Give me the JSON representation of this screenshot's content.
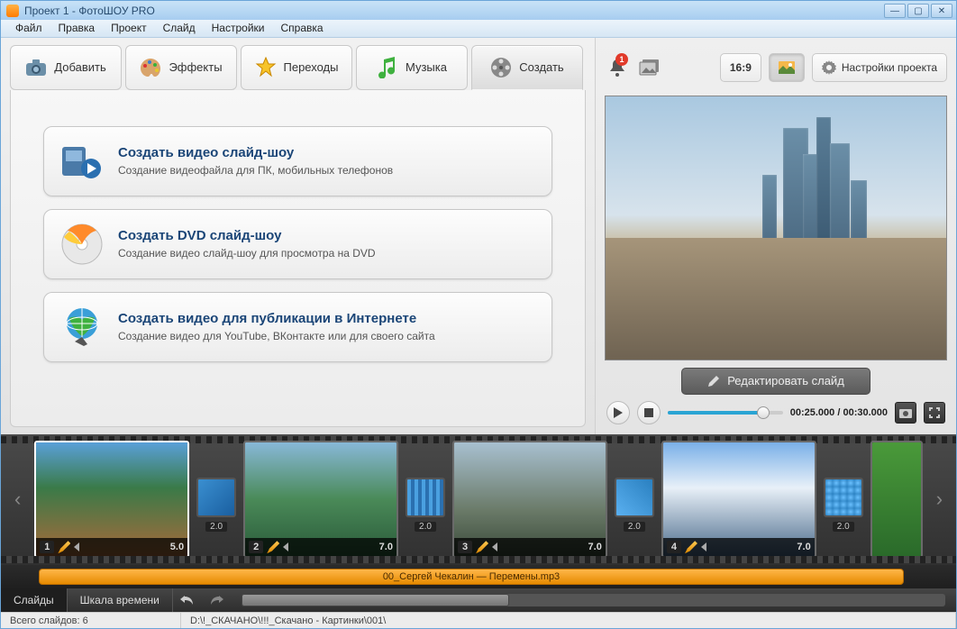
{
  "window": {
    "title": "Проект 1 - ФотоШОУ PRO"
  },
  "menu": [
    "Файл",
    "Правка",
    "Проект",
    "Слайд",
    "Настройки",
    "Справка"
  ],
  "tabs": {
    "add": "Добавить",
    "effects": "Эффекты",
    "transitions": "Переходы",
    "music": "Музыка",
    "create": "Создать"
  },
  "create_options": [
    {
      "title": "Создать видео слайд-шоу",
      "desc": "Создание видеофайла для ПК, мобильных телефонов"
    },
    {
      "title": "Создать DVD слайд-шоу",
      "desc": "Создание видео слайд-шоу для просмотра на DVD"
    },
    {
      "title": "Создать видео для публикации в Интернете",
      "desc": "Создание видео для YouTube, ВКонтакте или для своего сайта"
    }
  ],
  "right": {
    "notifications": "1",
    "aspect": "16:9",
    "settings": "Настройки проекта",
    "edit_slide": "Редактировать слайд",
    "time_current": "00:25.000",
    "time_total": "00:30.000"
  },
  "slides": [
    {
      "num": "1",
      "dur": "5.0"
    },
    {
      "num": "2",
      "dur": "7.0"
    },
    {
      "num": "3",
      "dur": "7.0"
    },
    {
      "num": "4",
      "dur": "7.0"
    }
  ],
  "transitions": [
    {
      "dur": "2.0"
    },
    {
      "dur": "2.0"
    },
    {
      "dur": "2.0"
    },
    {
      "dur": "2.0"
    }
  ],
  "audio": {
    "clip": "00_Сергей Чекалин — Перемены.mp3"
  },
  "views": {
    "slides": "Слайды",
    "timeline": "Шкала времени"
  },
  "status": {
    "count_label": "Всего слайдов: 6",
    "path": "D:\\!_СКАЧАНО\\!!!_Скачано - Картинки\\001\\"
  }
}
